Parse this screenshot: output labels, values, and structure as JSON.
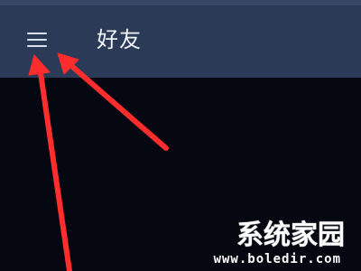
{
  "app_bar": {
    "title": "好友",
    "menu_icon": "hamburger-menu-icon"
  },
  "watermark": {
    "site_name": "系统家园",
    "url": "www.boledir.com"
  },
  "colors": {
    "app_bar": "#2b3a56",
    "background": "#050711",
    "annotation_arrow": "#ff2d2d"
  }
}
